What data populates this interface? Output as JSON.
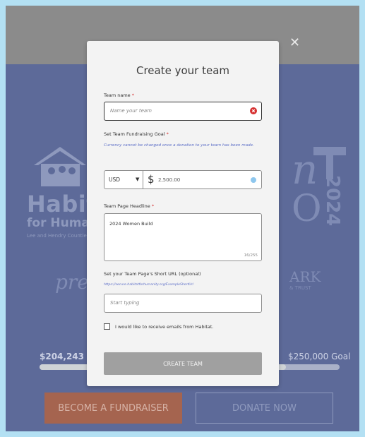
{
  "modal": {
    "close_icon": "close-icon",
    "title": "Create your team",
    "team_name": {
      "label": "Team name",
      "required_mark": "*",
      "placeholder": "Name your team",
      "error_icon": "error-icon",
      "error_color": "#d63030"
    },
    "goal": {
      "label": "Set Team Fundraising Goal",
      "required_mark": "*",
      "hint": "Currency cannot be changed once a donation to your team has been made.",
      "currency": "USD",
      "symbol": "$",
      "amount": "2,500.00"
    },
    "headline": {
      "label": "Team Page Headline",
      "required_mark": "*",
      "value": "2024 Women Build",
      "counter": "16/255"
    },
    "short_url": {
      "label": "Set your Team Page's Short URL (optional)",
      "hint": "https://secure.habitatforhumanity.org/ExampleShortUrl",
      "placeholder": "Start typing"
    },
    "optin": {
      "label": "I would like to receive emails from Habitat.",
      "checked": false
    },
    "submit_label": "CREATE TEAM"
  },
  "background": {
    "org_line1": "Habitat",
    "org_line2": "for Humanity",
    "org_line3": "Lee and Hendry Counties",
    "presented": "presented by",
    "sponsor": "ARK",
    "sponsor_sub": "& TRUST",
    "year": "2024",
    "raised": "$204,243 Raised",
    "goal": "$250,000 Goal",
    "progress_fraction": 0.82,
    "fundraiser_button": "BECOME A FUNDRAISER",
    "donate_button": "DONATE NOW"
  },
  "colors": {
    "accent": "#5c6ec7",
    "page_bg": "#5d6a99",
    "fundraiser": "#a5644f"
  }
}
